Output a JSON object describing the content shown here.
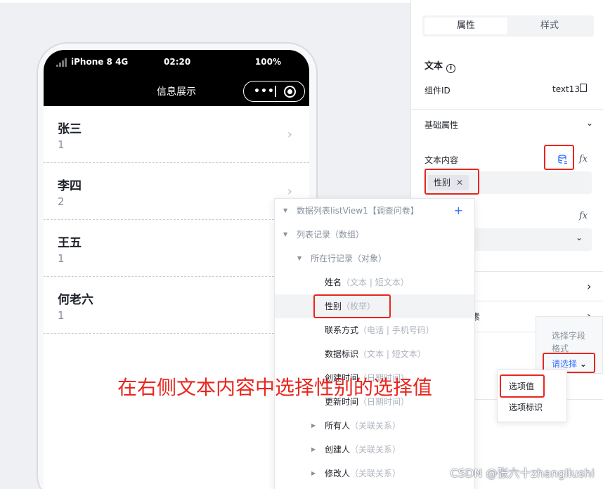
{
  "phone": {
    "device": "iPhone 8  4G",
    "time": "02:20",
    "battery": "100%",
    "nav_title": "信息展示",
    "capsule_dots": "•••",
    "list": [
      {
        "name": "张三",
        "value": "1"
      },
      {
        "name": "李四",
        "value": "2"
      },
      {
        "name": "王五",
        "value": "1"
      },
      {
        "name": "何老六",
        "value": "1"
      }
    ]
  },
  "panel": {
    "tabs": [
      "属性",
      "样式"
    ],
    "component_type": "文本",
    "component_id_label": "组件ID",
    "component_id_value": "text13",
    "section_basic": "基础属性",
    "text_content_label": "文本内容",
    "chip_label": "性别",
    "fx_label": "fx",
    "partial_label": "素"
  },
  "tree": {
    "root": "数据列表listView1【调查问卷】",
    "records": "列表记录（数组）",
    "current": "所在行记录（对象）",
    "fields": [
      {
        "name": "姓名",
        "hint": "（文本 | 短文本）"
      },
      {
        "name": "性别",
        "hint": "（枚举）"
      },
      {
        "name": "联系方式",
        "hint": "（电话 | 手机号码）"
      },
      {
        "name": "数据标识",
        "hint": "（文本 | 短文本）"
      },
      {
        "name": "创建时间",
        "hint": "（日期时间）"
      },
      {
        "name": "更新时间",
        "hint": "（日期时间）"
      }
    ],
    "relations": [
      {
        "name": "所有人",
        "hint": "（关联关系）"
      },
      {
        "name": "创建人",
        "hint": "（关联关系）"
      },
      {
        "name": "修改人",
        "hint": "（关联关系）"
      }
    ]
  },
  "format_popup": {
    "title1": "选择字段",
    "title2": "格式",
    "select": "请选择",
    "options": [
      "选项值",
      "选项标识"
    ]
  },
  "annotation": "在右侧文本内容中选择性别的选择值",
  "watermark": "CSDN @张六十zhangliushi",
  "colors": {
    "accent": "#3370ff",
    "highlight": "#e8261f"
  }
}
